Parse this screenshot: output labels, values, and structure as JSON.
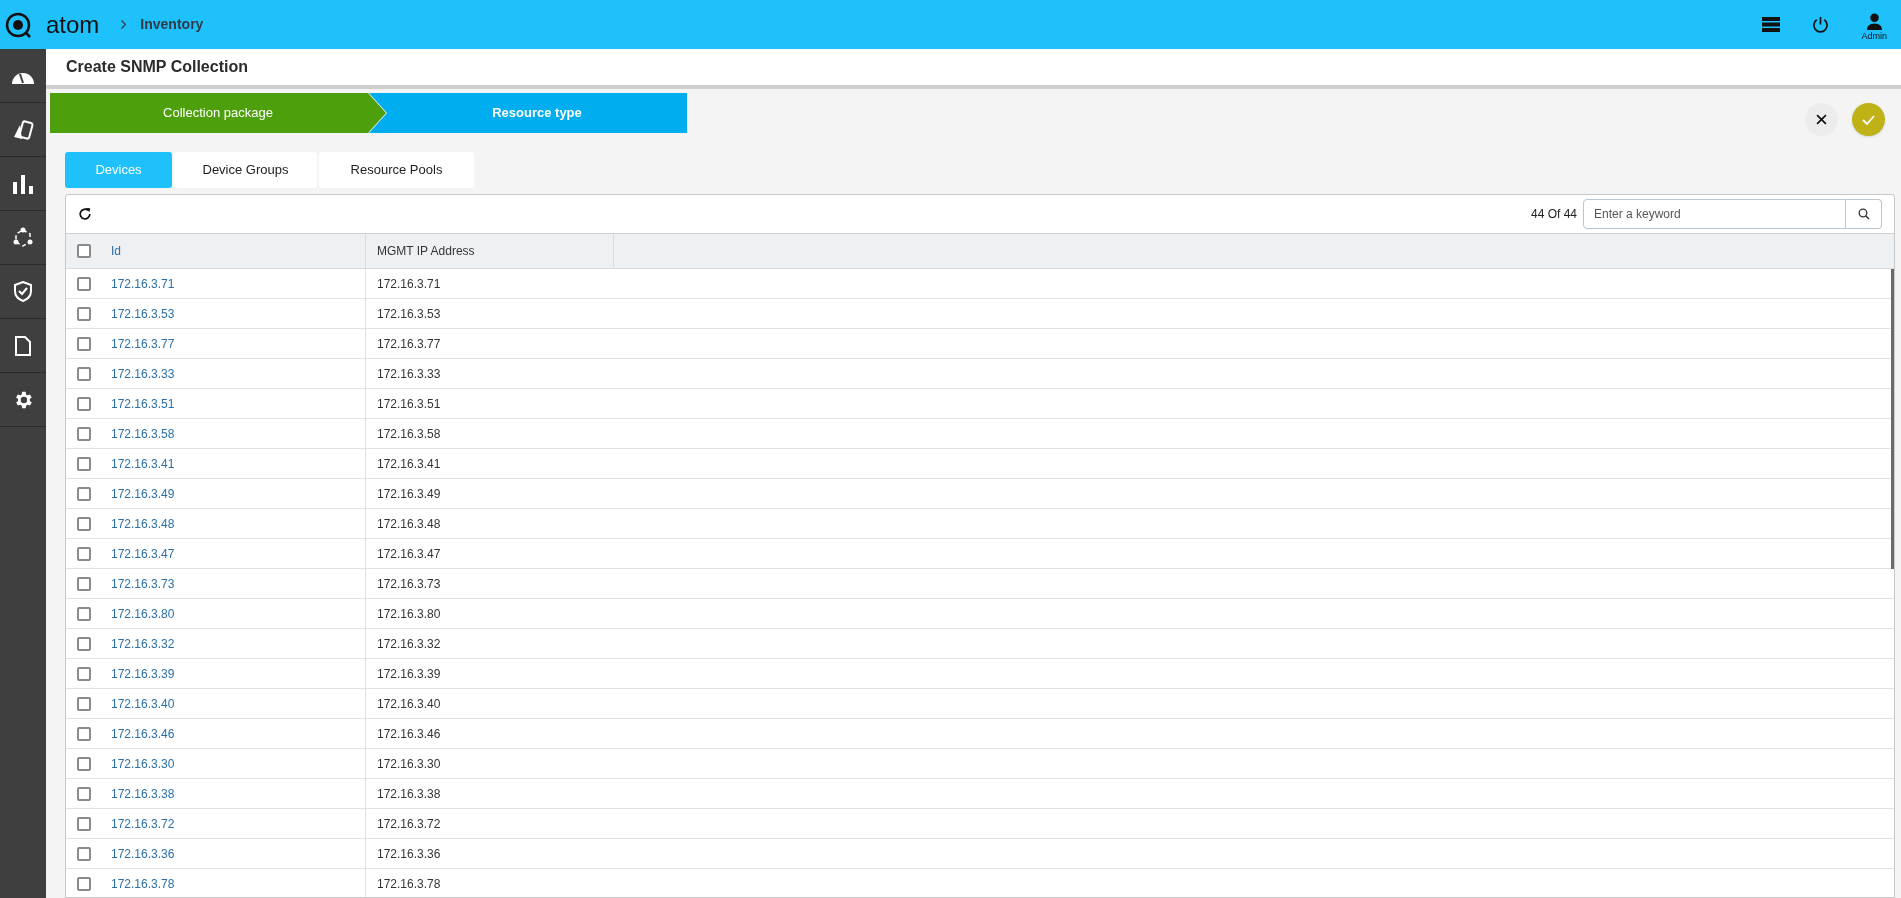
{
  "header": {
    "logo_text": "atom",
    "breadcrumb": "Inventory",
    "user_label": "Admin"
  },
  "page_title": "Create SNMP Collection",
  "steps": [
    {
      "label": "Collection package",
      "completed": true
    },
    {
      "label": "Resource type",
      "completed": false
    }
  ],
  "tabs": [
    {
      "label": "Devices",
      "selected": true
    },
    {
      "label": "Device Groups",
      "selected": false
    },
    {
      "label": "Resource Pools",
      "selected": false
    }
  ],
  "table": {
    "count": "44 Of 44",
    "search": {
      "placeholder": "Enter a keyword"
    },
    "select_all_checked": false,
    "columns": [
      "Id",
      "MGMT IP Address"
    ],
    "rows": [
      {
        "id": "172.16.3.71",
        "ip": "172.16.3.71",
        "checked": false
      },
      {
        "id": "172.16.3.53",
        "ip": "172.16.3.53",
        "checked": false
      },
      {
        "id": "172.16.3.77",
        "ip": "172.16.3.77",
        "checked": false
      },
      {
        "id": "172.16.3.33",
        "ip": "172.16.3.33",
        "checked": false
      },
      {
        "id": "172.16.3.51",
        "ip": "172.16.3.51",
        "checked": false
      },
      {
        "id": "172.16.3.58",
        "ip": "172.16.3.58",
        "checked": false
      },
      {
        "id": "172.16.3.41",
        "ip": "172.16.3.41",
        "checked": false
      },
      {
        "id": "172.16.3.49",
        "ip": "172.16.3.49",
        "checked": false
      },
      {
        "id": "172.16.3.48",
        "ip": "172.16.3.48",
        "checked": false
      },
      {
        "id": "172.16.3.47",
        "ip": "172.16.3.47",
        "checked": false
      },
      {
        "id": "172.16.3.73",
        "ip": "172.16.3.73",
        "checked": false
      },
      {
        "id": "172.16.3.80",
        "ip": "172.16.3.80",
        "checked": false
      },
      {
        "id": "172.16.3.32",
        "ip": "172.16.3.32",
        "checked": false
      },
      {
        "id": "172.16.3.39",
        "ip": "172.16.3.39",
        "checked": false
      },
      {
        "id": "172.16.3.40",
        "ip": "172.16.3.40",
        "checked": false
      },
      {
        "id": "172.16.3.46",
        "ip": "172.16.3.46",
        "checked": false
      },
      {
        "id": "172.16.3.30",
        "ip": "172.16.3.30",
        "checked": false
      },
      {
        "id": "172.16.3.38",
        "ip": "172.16.3.38",
        "checked": false
      },
      {
        "id": "172.16.3.72",
        "ip": "172.16.3.72",
        "checked": false
      },
      {
        "id": "172.16.3.36",
        "ip": "172.16.3.36",
        "checked": false
      },
      {
        "id": "172.16.3.78",
        "ip": "172.16.3.78",
        "checked": false
      }
    ]
  }
}
